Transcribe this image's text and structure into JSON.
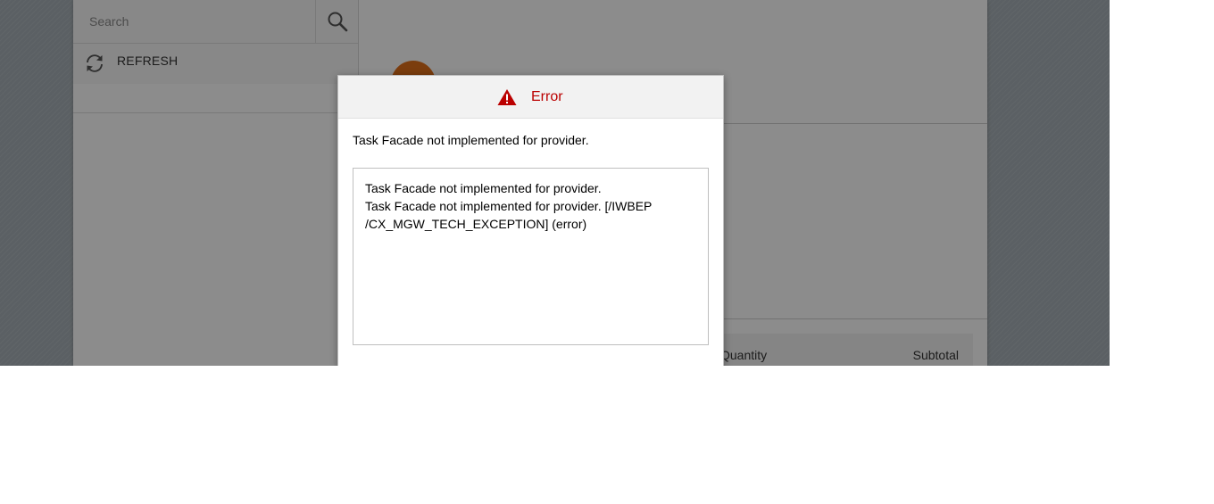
{
  "master": {
    "search": {
      "placeholder": "Search",
      "value": ""
    },
    "refresh_label": "REFRESH"
  },
  "items_table": {
    "columns": [
      "Quantity",
      "Subtotal"
    ]
  },
  "dialog": {
    "title": "Error",
    "message": "Task Facade not implemented for provider.",
    "details": [
      "Task Facade not implemented for provider.",
      "Task Facade not implemented for provider. [/IWBEP",
      "/CX_MGW_TECH_EXCEPTION] (error)"
    ]
  },
  "colors": {
    "error": "#bb0000",
    "avatar": "#e0701b"
  },
  "icons": {
    "search": "search-icon",
    "refresh": "refresh-icon",
    "error": "warning-icon"
  }
}
